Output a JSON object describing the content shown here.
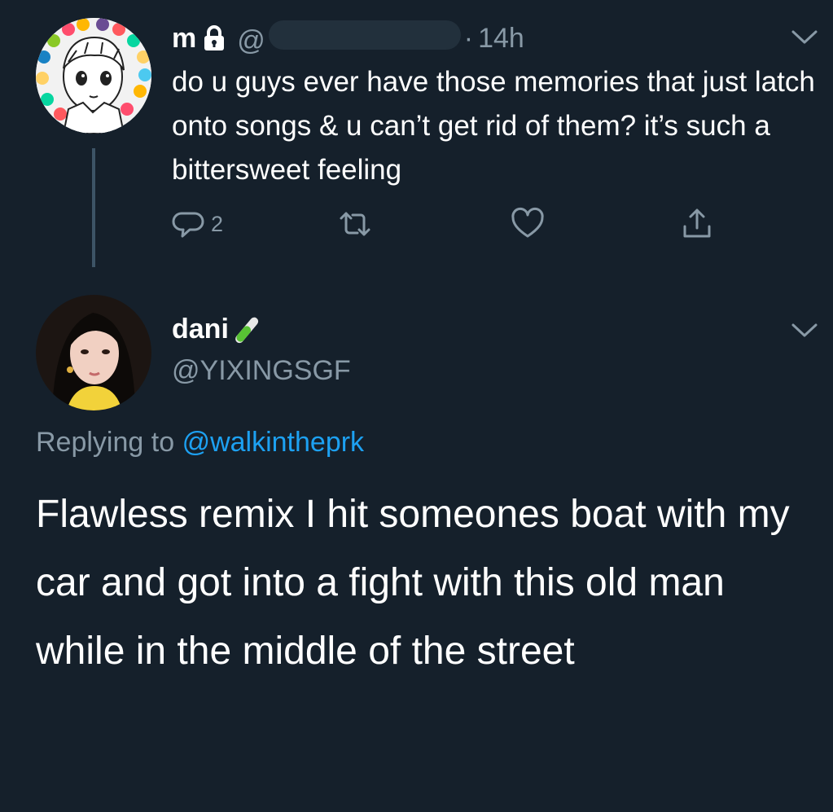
{
  "tweet_one": {
    "display_name": "m",
    "handle_prefix": "@",
    "separator": "·",
    "timestamp": "14h",
    "text": "do u guys ever have those memories that just latch onto songs & u can’t get rid of them? it’s such a bittersweet feeling",
    "reply_count": "2"
  },
  "tweet_two": {
    "display_name": "dani",
    "handle": "@YIXINGSGF",
    "replying_label": "Replying to",
    "replying_to": "@walkintheprk",
    "text": "Flawless remix I hit someones boat with my car and got into a fight with this old man while in the middle of the street"
  },
  "icons": {
    "lock": "lock-icon",
    "chevron": "chevron-down-icon",
    "reply": "reply-icon",
    "retweet": "retweet-icon",
    "like": "heart-icon",
    "share": "share-icon",
    "emoji": "test-tube-icon"
  },
  "colors": {
    "background": "#15202b",
    "text": "#ffffff",
    "secondary_text": "#8899a6",
    "link": "#1da1f2",
    "thread_line": "#3d5466"
  }
}
